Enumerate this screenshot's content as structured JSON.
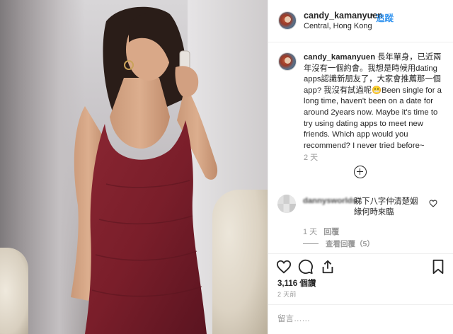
{
  "post": {
    "username": "candy_kamanyuen",
    "follow_label": "追蹤",
    "location": "Central, Hong Kong"
  },
  "caption": {
    "username": "candy_kamanyuen",
    "text": "長年單身，已近兩年沒有一個約會。我想是時候用dating apps認識新朋友了，大家會推薦那一個app? 我沒有試過呢😬Been single for a long time, haven't been on a date for around 2years now. Maybe it's time to try using dating apps to meet new friends. Which app would you recommend? I never tried before~",
    "time": "2 天"
  },
  "comment": {
    "username": "dannysworlds",
    "text": "睇下八字仲清楚姻緣何時來臨",
    "time": "1 天",
    "reply_label": "回覆",
    "view_replies": "查看回覆（5）"
  },
  "stats": {
    "likes": "3,116 個讚",
    "post_time": "2 天前"
  },
  "comment_box": {
    "placeholder": "留言……"
  },
  "colors": {
    "link_blue": "#3897f0",
    "text": "#262626",
    "muted": "#999999",
    "dress": "#7a1e2a"
  },
  "icons": [
    "heart-icon",
    "comment-icon",
    "share-icon",
    "bookmark-icon",
    "plus-circle-icon"
  ]
}
